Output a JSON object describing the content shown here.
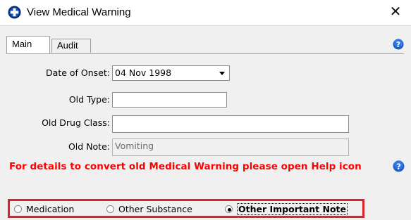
{
  "window": {
    "title": "View Medical Warning",
    "close_label": "✕"
  },
  "tabs": [
    {
      "label": "Main",
      "active": true
    },
    {
      "label": "Audit",
      "active": false
    }
  ],
  "form": {
    "date_of_onset": {
      "label": "Date of Onset:",
      "value": "04 Nov 1998"
    },
    "old_type": {
      "label": "Old Type:",
      "value": ""
    },
    "old_drug_class": {
      "label": "Old Drug Class:",
      "value": ""
    },
    "old_note": {
      "label": "Old Note:",
      "value": "Vomiting"
    }
  },
  "warning": {
    "text": "For details to convert old Medical Warning please open Help icon",
    "color": "#ff0000"
  },
  "warning_type": {
    "options": [
      {
        "label": "Medication",
        "selected": false
      },
      {
        "label": "Other Substance",
        "selected": false
      },
      {
        "label": "Other Important Note",
        "selected": true
      }
    ],
    "highlight_color": "#e0202a"
  },
  "icons": {
    "title": "medical-cross-icon",
    "help": "help-icon"
  }
}
